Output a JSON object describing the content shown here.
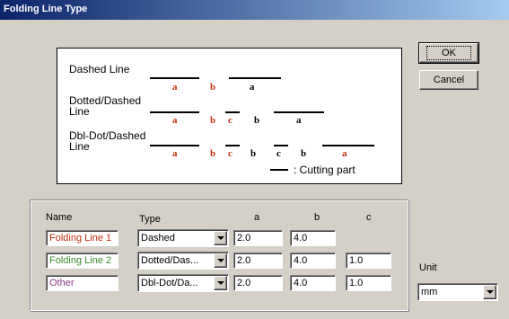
{
  "window": {
    "title": "Folding Line Type"
  },
  "buttons": {
    "ok": "OK",
    "cancel": "Cancel"
  },
  "diagram": {
    "dashed_label": "Dashed Line",
    "dotted_label_1": "Dotted/Dashed",
    "dotted_label_2": "Line",
    "dbldot_label_1": "Dbl-Dot/Dashed",
    "dbldot_label_2": "Line",
    "legend_label": ": Cutting part",
    "letters": {
      "a": "a",
      "b": "b",
      "c": "c"
    },
    "colors": {
      "red": "#c03010",
      "black": "#000000"
    }
  },
  "table": {
    "headers": {
      "name": "Name",
      "type": "Type",
      "a": "a",
      "b": "b",
      "c": "c"
    },
    "rows": [
      {
        "name": "Folding Line 1",
        "name_color": "#c03010",
        "type": "Dashed",
        "a": "2.0",
        "b": "4.0",
        "c": ""
      },
      {
        "name": "Folding Line 2",
        "name_color": "#3a8a2a",
        "type": "Dotted/Das...",
        "a": "2.0",
        "b": "4.0",
        "c": "1.0"
      },
      {
        "name": "Other",
        "name_color": "#8a3a8a",
        "type": "Dbl-Dot/Da...",
        "a": "2.0",
        "b": "4.0",
        "c": "1.0"
      }
    ]
  },
  "unit": {
    "label": "Unit",
    "value": "mm"
  },
  "icons": {
    "dropdown": "chevron-down-icon"
  }
}
